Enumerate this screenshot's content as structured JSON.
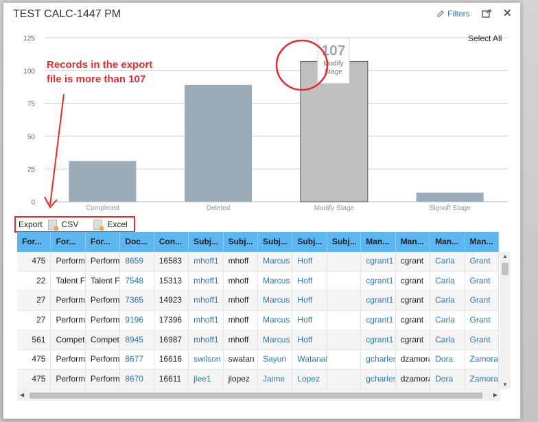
{
  "dialog": {
    "title": "TEST CALC-1447 PM",
    "filters_label": "Filters",
    "icons": {
      "filter": "pencil-icon",
      "popout": "popout-icon",
      "close": "close-icon"
    }
  },
  "select_all": "Select All",
  "annotation": {
    "line1": "Records in the export",
    "line2": "file is more than 107",
    "color": "#e52a2a"
  },
  "chart_data": {
    "type": "bar",
    "categories": [
      "Completed",
      "Deleted",
      "Modify Stage",
      "Signoff Stage"
    ],
    "values": [
      31,
      89,
      107,
      7
    ],
    "ylim": [
      0,
      125
    ],
    "yticks": [
      0,
      25,
      50,
      75,
      100,
      125
    ],
    "grid": true,
    "highlighted": "Modify Stage",
    "tooltip": {
      "value": "107",
      "label_line1": "Modify",
      "label_line2": "Stage"
    },
    "colors": {
      "bar": "#9aabba",
      "highlight": "#c0c0c0",
      "highlight_border": "#555555"
    }
  },
  "export": {
    "label": "Export",
    "csv": "CSV",
    "excel": "Excel"
  },
  "table": {
    "headers": [
      "For...",
      "For...",
      "For...",
      "Doc...",
      "Con...",
      "Subj...",
      "Subj...",
      "Subj...",
      "Subj...",
      "Subj...",
      "Man...",
      "Man...",
      "Man...",
      "Man..."
    ],
    "rows": [
      [
        "475",
        "Performa",
        "Performa",
        "8659",
        "16583",
        "mhoff1",
        "mhoff",
        "Marcus",
        "Hoff",
        "",
        "cgrant1",
        "cgrant",
        "Carla",
        "Grant"
      ],
      [
        "22",
        "Talent Fl",
        "Talent Fl",
        "7548",
        "15313",
        "mhoff1",
        "mhoff",
        "Marcus",
        "Hoff",
        "",
        "cgrant1",
        "cgrant",
        "Carla",
        "Grant"
      ],
      [
        "27",
        "Performa",
        "Performa",
        "7365",
        "14923",
        "mhoff1",
        "mhoff",
        "Marcus",
        "Hoff",
        "",
        "cgrant1",
        "cgrant",
        "Carla",
        "Grant"
      ],
      [
        "27",
        "Performa",
        "Performa",
        "9196",
        "17396",
        "mhoff1",
        "mhoff",
        "Marcus",
        "Hoff",
        "",
        "cgrant1",
        "cgrant",
        "Carla",
        "Grant"
      ],
      [
        "561",
        "Compete",
        "Compete",
        "8945",
        "16987",
        "mhoff1",
        "mhoff",
        "Marcus",
        "Hoff",
        "",
        "cgrant1",
        "cgrant",
        "Carla",
        "Grant"
      ],
      [
        "475",
        "Performa",
        "Performa",
        "8677",
        "16616",
        "swilson",
        "swatan",
        "Sayuri",
        "Watanabe",
        "",
        "gcharles",
        "dzamora",
        "Dora",
        "Zamora"
      ],
      [
        "475",
        "Performa",
        "Performa",
        "8670",
        "16611",
        "jlee1",
        "jlopez",
        "Jaime",
        "Lopez",
        "",
        "gcharles",
        "dzamora",
        "Dora",
        "Zamora"
      ]
    ]
  }
}
